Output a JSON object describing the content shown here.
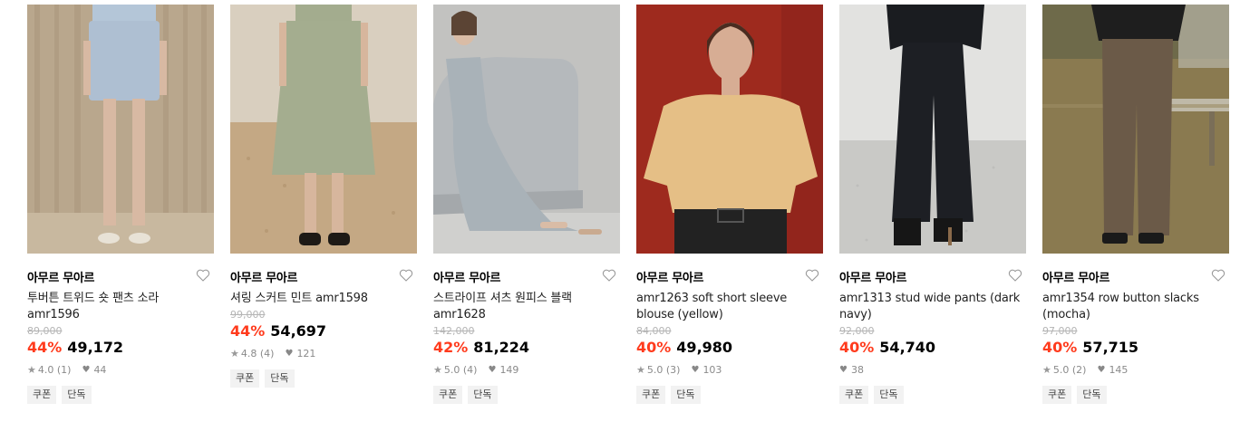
{
  "products": [
    {
      "brand": "아무르 무아르",
      "name": "투버튼 트위드 숏 팬츠 소라 amr1596",
      "original_price": "89,000",
      "discount": "44%",
      "price": "49,172",
      "rating": "4.0",
      "reviews": "(1)",
      "likes": "44",
      "tags": [
        "쿠폰",
        "단독"
      ],
      "colors": {
        "bg": "#b7a58c",
        "item": "#aebfd2",
        "skin": "#d8b9a3"
      }
    },
    {
      "brand": "아무르 무아르",
      "name": "셔링 스커트 민트 amr1598",
      "original_price": "99,000",
      "discount": "44%",
      "price": "54,697",
      "rating": "4.8",
      "reviews": "(4)",
      "likes": "121",
      "tags": [
        "쿠폰",
        "단독"
      ],
      "colors": {
        "bg": "#c9b18d",
        "item": "#a4ad8f",
        "skin": "#d7b69d"
      }
    },
    {
      "brand": "아무르 무아르",
      "name": "스트라이프 셔츠 원피스 블랙 amr1628",
      "original_price": "142,000",
      "discount": "42%",
      "price": "81,224",
      "rating": "5.0",
      "reviews": "(4)",
      "likes": "149",
      "tags": [
        "쿠폰",
        "단독"
      ],
      "colors": {
        "bg": "#bfbfbf",
        "item": "#a9b2b8",
        "skin": "#d9bca6"
      }
    },
    {
      "brand": "아무르 무아르",
      "name": "amr1263 soft short sleeve blouse (yellow)",
      "original_price": "84,000",
      "discount": "40%",
      "price": "49,980",
      "rating": "5.0",
      "reviews": "(3)",
      "likes": "103",
      "tags": [
        "쿠폰",
        "단독"
      ],
      "colors": {
        "bg": "#9e2a1e",
        "item": "#e5bf86",
        "skin": "#d7ad94"
      }
    },
    {
      "brand": "아무르 무아르",
      "name": "amr1313 stud wide pants (dark navy)",
      "original_price": "92,000",
      "discount": "40%",
      "price": "54,740",
      "rating": "",
      "reviews": "",
      "likes": "38",
      "tags": [
        "쿠폰",
        "단독"
      ],
      "colors": {
        "bg": "#d8d8d6",
        "item": "#1d1f24",
        "skin": "#c49a80"
      }
    },
    {
      "brand": "아무르 무아르",
      "name": "amr1354 row button slacks (mocha)",
      "original_price": "97,000",
      "discount": "40%",
      "price": "57,715",
      "rating": "5.0",
      "reviews": "(2)",
      "likes": "145",
      "tags": [
        "쿠폰",
        "단독"
      ],
      "colors": {
        "bg": "#8c7a4e",
        "item": "#6b5a48",
        "skin": "#c9a489"
      }
    }
  ]
}
